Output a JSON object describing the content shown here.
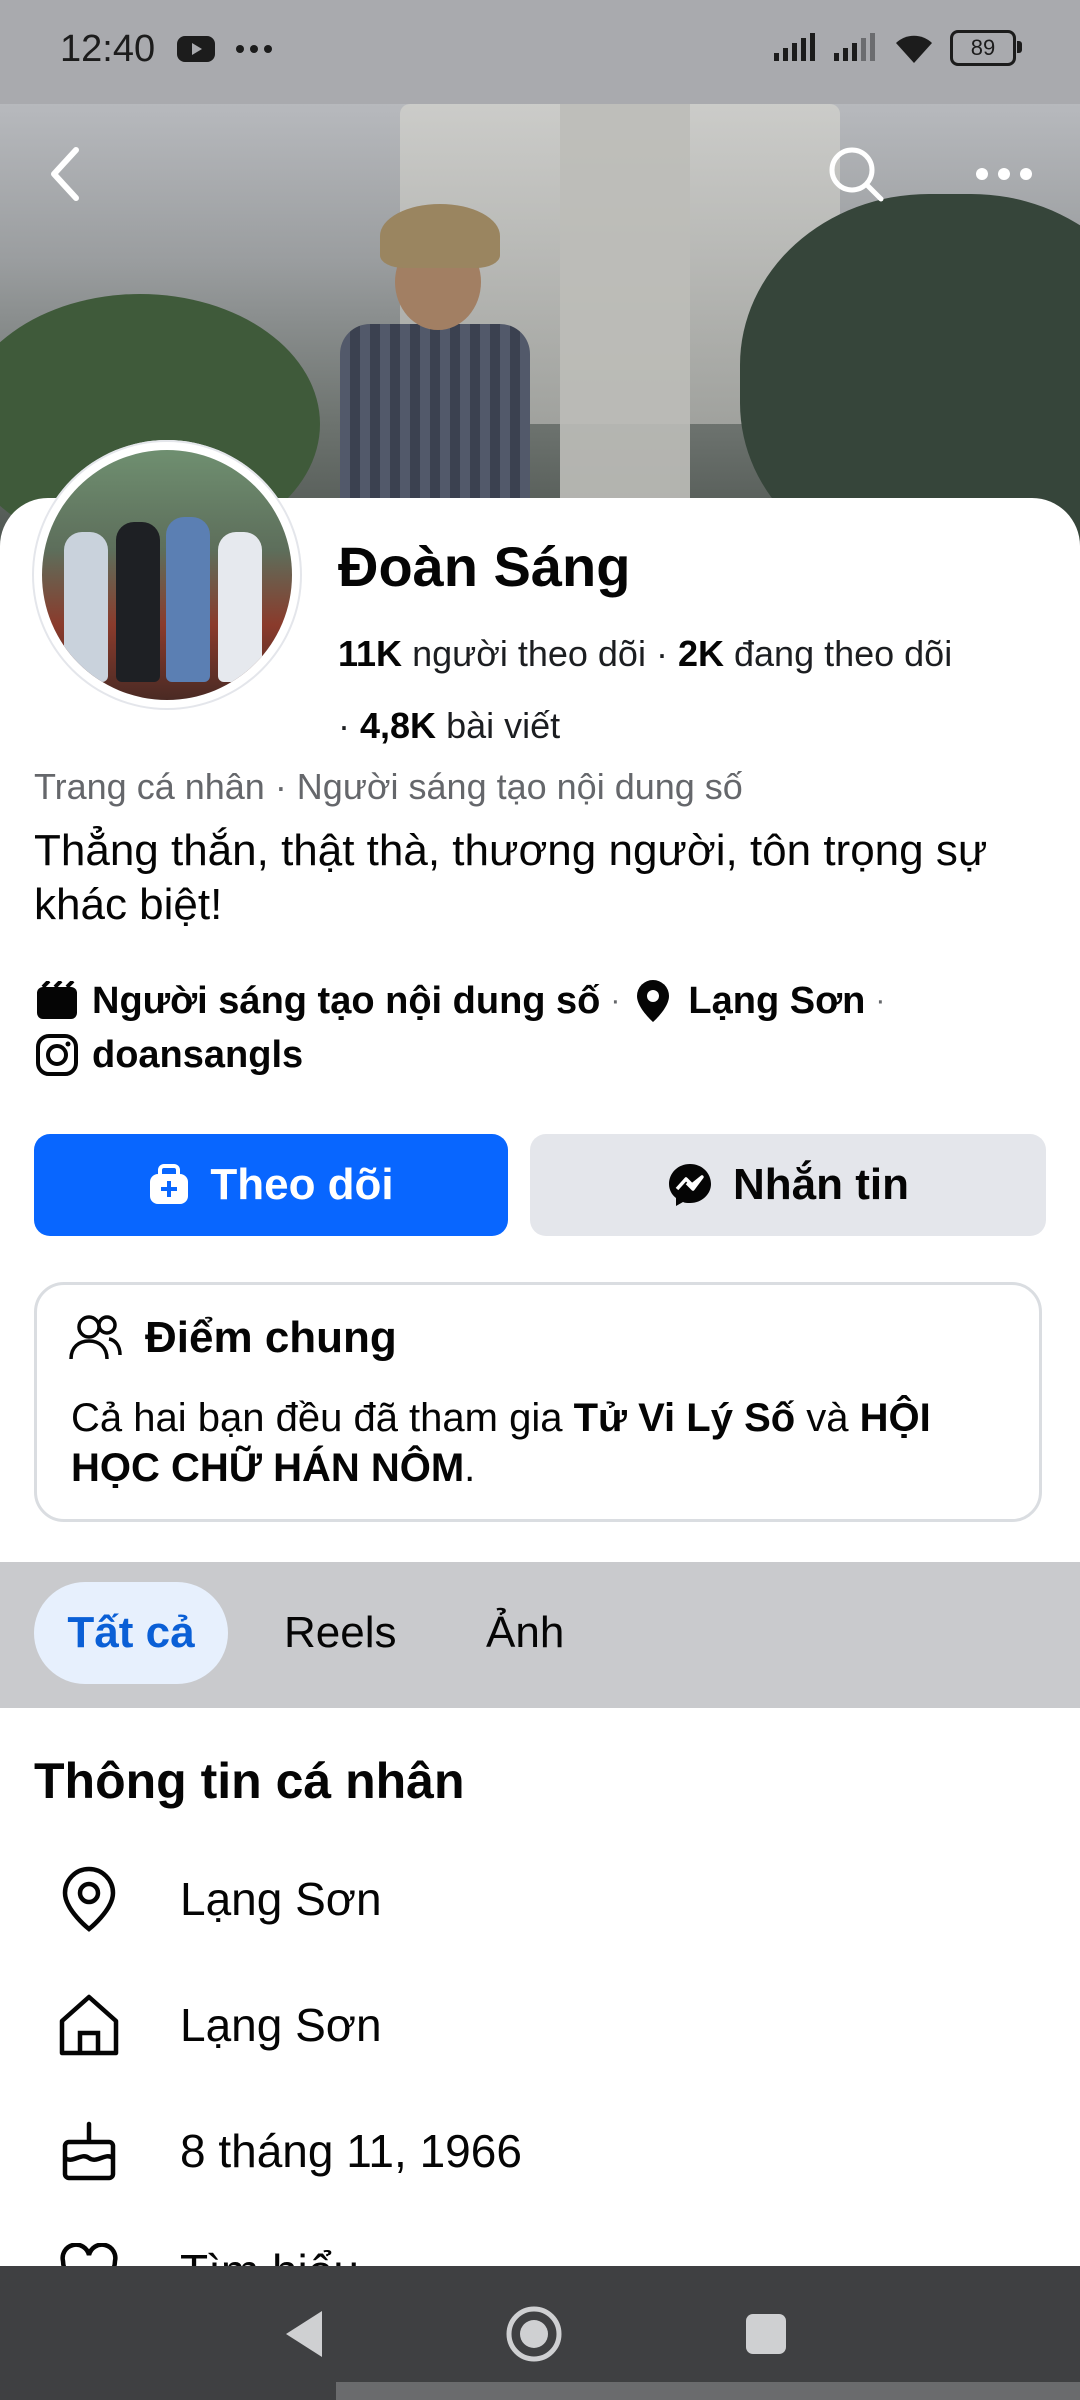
{
  "status_bar": {
    "time": "12:40",
    "battery": "89"
  },
  "cover": {
    "back_icon": "back-arrow-icon",
    "search_icon": "search-icon",
    "more_icon": "more-icon"
  },
  "profile": {
    "name": "Đoàn Sáng",
    "followers_count": "11K",
    "followers_label": "người theo dõi",
    "following_count": "2K",
    "following_label": "đang theo dõi",
    "posts_count": "4,8K",
    "posts_label": "bài viết",
    "category": "Trang cá nhân · Người sáng tạo nội dung số",
    "bio": "Thẳng thắn, thật thà, thương người, tôn trọng sự khác biệt!",
    "detail_creator": "Người sáng tạo nội dung số",
    "detail_location": "Lạng Sơn",
    "detail_instagram": "doansangls"
  },
  "actions": {
    "follow_label": "Theo dõi",
    "message_label": "Nhắn tin"
  },
  "mutual": {
    "title": "Điểm chung",
    "text_before": "Cả hai bạn đều đã tham gia ",
    "group1": "Tử Vi Lý Số",
    "text_and": " và ",
    "group2": "HỘI HỌC CHỮ HÁN NÔM",
    "text_end": "."
  },
  "tabs": [
    {
      "label": "Tất cả",
      "active": true
    },
    {
      "label": "Reels",
      "active": false
    },
    {
      "label": "Ảnh",
      "active": false
    }
  ],
  "about": {
    "title": "Thông tin cá nhân",
    "items": [
      {
        "icon": "location-pin-icon",
        "text": "Lạng Sơn"
      },
      {
        "icon": "home-icon",
        "text": "Lạng Sơn"
      },
      {
        "icon": "birthday-cake-icon",
        "text": "8 tháng 11, 1966"
      },
      {
        "icon": "heart-icon",
        "text": "Tìm hiểu"
      }
    ]
  },
  "colors": {
    "primary": "#0866ff",
    "secondary_button": "#e4e6eb",
    "active_tab_bg": "#e7f0fd",
    "muted_text": "#65676b"
  }
}
